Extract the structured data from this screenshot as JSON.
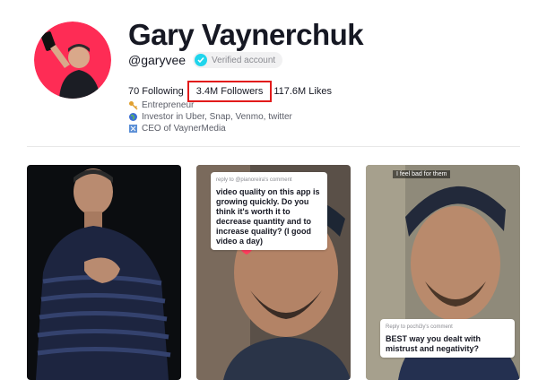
{
  "profile": {
    "name": "Gary Vaynerchuk",
    "handle": "@garyvee",
    "verified_label": "Verified account"
  },
  "stats": {
    "following": "70 Following",
    "followers": "3.4M Followers",
    "likes": "117.6M Likes"
  },
  "bio": [
    {
      "icon": "key-icon",
      "text": "Entrepreneur"
    },
    {
      "icon": "globe-icon",
      "text": "Investor in Uber, Snap, Venmo, twitter"
    },
    {
      "icon": "medal-icon",
      "text": "CEO of VaynerMedia"
    }
  ],
  "videos": [
    {
      "caption": ""
    },
    {
      "reply_meta": "reply to @pianoreira's comment",
      "comment": "video quality on this app is growing quickly. Do you think it's worth it to decrease quantity and to increase quality? (I good video a day)"
    },
    {
      "top_caption": "I feel bad for them",
      "reply_meta": "Reply to pochi3y's comment",
      "comment": "BEST way you dealt with mistrust and negativity?"
    }
  ],
  "colors": {
    "accent": "#e21b1b",
    "verified": "#20d5ec",
    "avatar_bg": "#fe2c55"
  }
}
